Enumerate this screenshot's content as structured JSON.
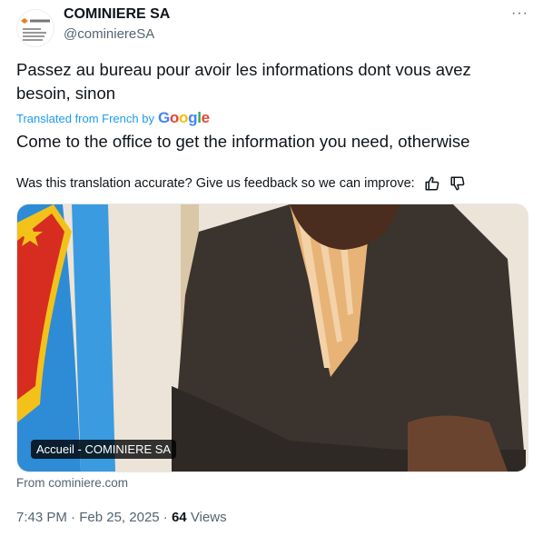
{
  "account": {
    "name": "COMINIERE SA",
    "handle": "@cominiereSA",
    "more_label": "···"
  },
  "tweet": {
    "text": "Passez au bureau pour avoir les informations dont vous avez besoin,  sinon",
    "translated_from": "Translated from French by",
    "translation_provider": "Google",
    "translation": "Come to the office to get the information you need, otherwise",
    "feedback_prompt": "Was this translation accurate? Give us feedback so we can improve:",
    "feedback_icons": [
      "thumbs-up-icon",
      "thumbs-down-icon"
    ]
  },
  "card": {
    "label": "Accueil - COMINIERE SA",
    "source": "From cominiere.com"
  },
  "meta": {
    "time": "7:43 PM",
    "separator": "·",
    "date": "Feb 25, 2025",
    "views_count": "64",
    "views_label": "Views"
  },
  "colors": {
    "accent": "#1d9bf0",
    "text": "#0f1419",
    "secondary": "#536471"
  }
}
